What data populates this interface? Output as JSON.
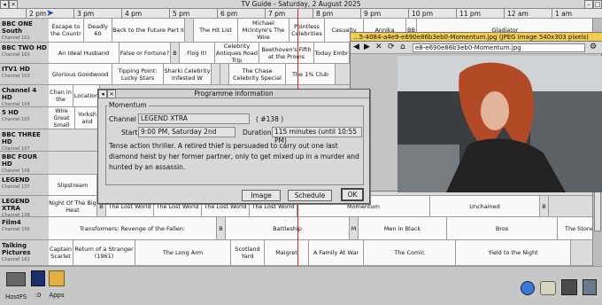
{
  "window": {
    "title": "TV Guide - Saturday,  2 August 2025"
  },
  "timeline": [
    "2 pm",
    "3 pm",
    "4 pm",
    "5 pm",
    "6 pm",
    "7 pm",
    "8 pm",
    "9 pm",
    "10 pm",
    "11 pm",
    "12 am",
    "1 am"
  ],
  "channels": [
    {
      "name": "BBC ONE South",
      "number": "Channel 101"
    },
    {
      "name": "BBC TWO HD",
      "number": "Channel 102"
    },
    {
      "name": "ITV1 HD",
      "number": "Channel 103"
    },
    {
      "name": "Channel 4 HD",
      "number": "Channel 104"
    },
    {
      "name": "5 HD",
      "number": "Channel 105"
    },
    {
      "name": "BBC THREE HD",
      "number": "Channel 107"
    },
    {
      "name": "BBC FOUR HD",
      "number": "Channel 106"
    },
    {
      "name": "LEGEND",
      "number": "Channel 137"
    },
    {
      "name": "LEGEND XTRA",
      "number": "Channel 138"
    },
    {
      "name": "Film4",
      "number": "Channel 156"
    },
    {
      "name": "Talking Pictures",
      "number": "Channel 182"
    }
  ],
  "programmes": [
    [
      "Escape to the Countr",
      "Deadly 60",
      "Back to the Future Part II",
      "",
      "The Hit List",
      "Michael McIntyre's The Wire",
      "Pointless Celebrities",
      "Casualty",
      "Annika",
      "BB",
      "Gladiator"
    ],
    [
      "An Ideal Husband",
      "False or Fortune?",
      "B",
      "Flog It!",
      "Celebrity Antiques Road Trip",
      "Beethoven's Fifth at the Proms",
      "Today Embr"
    ],
    [
      "Glorious Goodwood",
      "Tipping Point: Lucky Stars",
      "Sharki Celebrity Infested W",
      "The Chase Celebrity Special",
      "The 1% Club"
    ],
    [
      "Chan in the",
      "Location"
    ],
    [
      "Wire Great Small",
      "Yorksh and"
    ],
    [],
    [],
    [
      "Slipstream"
    ],
    [
      "Night Of The Big Heat",
      "B",
      "The Lost World",
      "The Lost World",
      "The Lost World",
      "The Lost World",
      "Momentum",
      "Unchained",
      "B"
    ],
    [
      "Transformers: Revenge of the Fallen:",
      "B",
      "Battleship",
      "M",
      "Men in Black",
      "Bros",
      "The Stone"
    ],
    [
      "Captain Scarlet",
      "Return of a Stranger (1961)",
      "The Long Arm",
      "Scotland Yard",
      "Maigret",
      "A Family At War",
      "The Comic",
      "Yield to the Night"
    ]
  ],
  "viewer": {
    "title": "...5-4084-a4e9-e690e86b3eb0-Momentum.jpg (JPEG image 540x303 pixels)",
    "url": "e8-e690e86b3eb0-Momentum.jpg"
  },
  "dialog": {
    "title": "Programme information",
    "programme": "Momentum",
    "channel_label": "Channel",
    "channel_value": "LEGEND XTRA",
    "channel_number": "( #138 )",
    "start_label": "Start",
    "start_value": "9:00 PM, Saturday  2nd",
    "duration_label": "Duration",
    "duration_value": "115 minutes (until 10:55 PM)",
    "description": "Tense action thriller. A retired thief is persuaded to carry out one last diamond heist by her former partner, only to get mixed up in a murder and hunted by an assassin.",
    "buttons": {
      "image": "Image",
      "schedule": "Schedule",
      "ok": "OK"
    }
  },
  "iconbar": {
    "hostfs": "HostFS",
    "disc": ":0",
    "apps": "Apps"
  },
  "colors": {
    "now_line": "#dd2222",
    "viewer_title": "#f2cc50"
  }
}
